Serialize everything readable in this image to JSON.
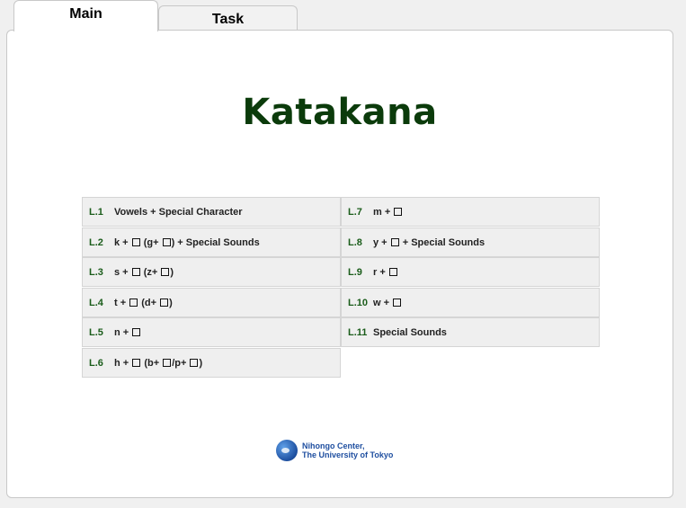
{
  "tabs": [
    {
      "label": "Main",
      "active": true
    },
    {
      "label": "Task",
      "active": false
    }
  ],
  "title": "Katakana",
  "lessons": [
    {
      "num": "L.1",
      "parts": [
        "Vowels + Special Character"
      ]
    },
    {
      "num": "L.2",
      "parts": [
        "k + ",
        "[]",
        " (g+ ",
        "[]",
        ") + Special Sounds"
      ]
    },
    {
      "num": "L.3",
      "parts": [
        "s + ",
        "[]",
        " (z+ ",
        "[]",
        ")"
      ]
    },
    {
      "num": "L.4",
      "parts": [
        "t + ",
        "[]",
        " (d+ ",
        "[]",
        ")"
      ]
    },
    {
      "num": "L.5",
      "parts": [
        "n + ",
        "[]"
      ]
    },
    {
      "num": "L.6",
      "parts": [
        "h + ",
        "[]",
        " (b+ ",
        "[]",
        "/p+ ",
        "[]",
        ")"
      ]
    },
    {
      "num": "L.7",
      "parts": [
        "m + ",
        "[]"
      ]
    },
    {
      "num": "L.8",
      "parts": [
        "y + ",
        "[]",
        " + Special Sounds"
      ]
    },
    {
      "num": "L.9",
      "parts": [
        "r + ",
        "[]"
      ]
    },
    {
      "num": "L.10",
      "parts": [
        "w + ",
        "[]"
      ]
    },
    {
      "num": "L.11",
      "parts": [
        "Special Sounds"
      ]
    }
  ],
  "footer": {
    "line1": "Nihongo Center,",
    "line2": "The University of Tokyo",
    "logo_icon": "globe-logo-icon"
  }
}
